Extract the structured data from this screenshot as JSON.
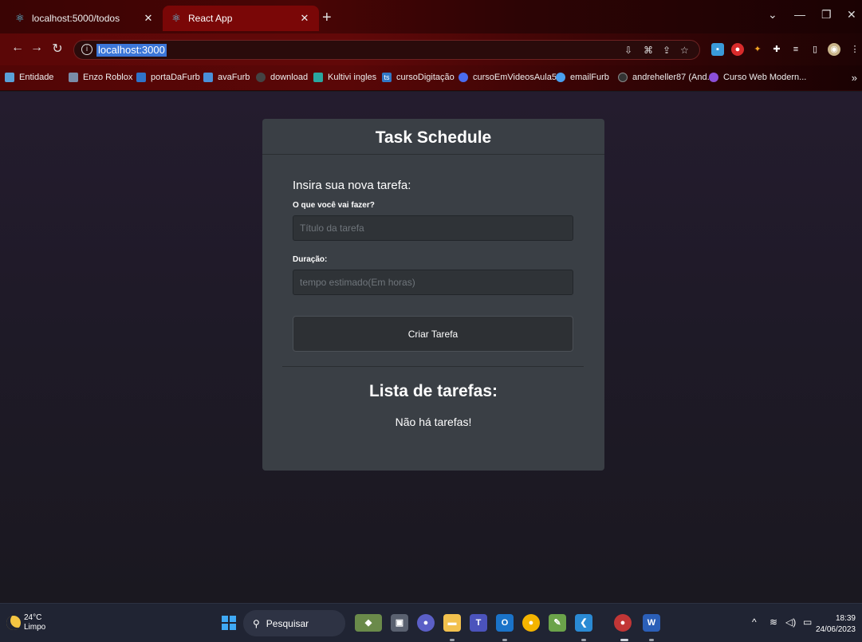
{
  "browser": {
    "tabs": [
      {
        "label": "localhost:5000/todos",
        "favicon": "react-icon",
        "active": false
      },
      {
        "label": "React App",
        "favicon": "react-icon",
        "active": true
      }
    ],
    "url": "localhost:3000",
    "bookmarks": [
      {
        "label": "Entidade",
        "icon": "entity-icon",
        "color": "#5aa0d8"
      },
      {
        "label": "Enzo Roblox",
        "icon": "roblox-icon",
        "color": "#7a8ca8"
      },
      {
        "label": "portaDaFurb",
        "icon": "furb-icon",
        "color": "#2f73c9"
      },
      {
        "label": "avaFurb",
        "icon": "ava-icon",
        "color": "#4a90d9"
      },
      {
        "label": "download",
        "icon": "download-icon",
        "color": "#444"
      },
      {
        "label": "Kultivi ingles",
        "icon": "kultivi-icon",
        "color": "#2aa7a0"
      },
      {
        "label": "cursoDigitação",
        "icon": "ts-icon",
        "color": "#3178c6"
      },
      {
        "label": "cursoEmVideosAula5",
        "icon": "video-icon",
        "color": "#4a6cf0"
      },
      {
        "label": "emailFurb",
        "icon": "email-icon",
        "color": "#4aa0f0"
      },
      {
        "label": "andreheller87 (And...",
        "icon": "github-icon",
        "color": "#333"
      },
      {
        "label": "Curso Web Modern...",
        "icon": "course-icon",
        "color": "#8b4fd8"
      }
    ],
    "bookmarks_more": "»"
  },
  "app": {
    "title": "Task Schedule",
    "form_heading": "Insira sua nova tarefa:",
    "task_label": "O que você vai fazer?",
    "task_placeholder": "Título da tarefa",
    "duration_label": "Duração:",
    "duration_placeholder": "tempo estimado(Em horas)",
    "create_button": "Criar Tarefa",
    "list_title": "Lista de tarefas:",
    "empty_message": "Não há tarefas!"
  },
  "taskbar": {
    "weather_temp": "24°C",
    "weather_desc": "Limpo",
    "search_placeholder": "Pesquisar",
    "time": "18:39",
    "date": "24/06/2023"
  }
}
